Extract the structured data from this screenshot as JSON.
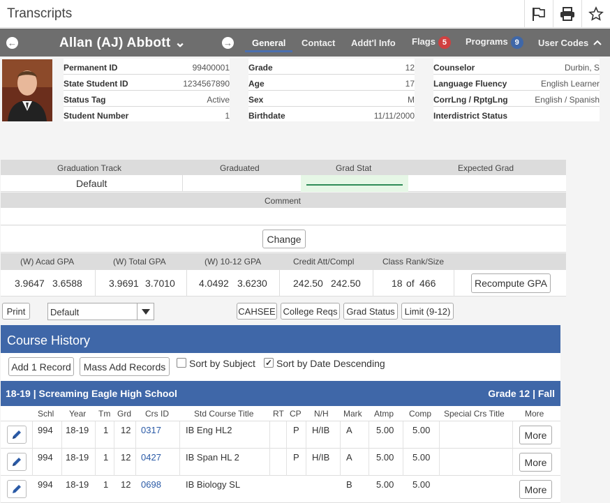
{
  "app": {
    "title": "Transcripts"
  },
  "header": {
    "student_name": "Allan (AJ) Abbott ⌄",
    "tabs": [
      {
        "label": "General"
      },
      {
        "label": "Contact"
      },
      {
        "label": "Addt'l Info"
      },
      {
        "label": "Flags",
        "badge": "5"
      },
      {
        "label": "Programs",
        "badge": "9"
      },
      {
        "label": "User Codes"
      }
    ],
    "colors": {
      "bar": "#6e6e6e",
      "flags_badge": "#d04040",
      "programs_badge": "#3f67a8"
    }
  },
  "student_info": {
    "col1": [
      {
        "label": "Permanent ID",
        "value": "99400001"
      },
      {
        "label": "State Student ID",
        "value": "1234567890"
      },
      {
        "label": "Status Tag",
        "value": "Active"
      },
      {
        "label": "Student Number",
        "value": "1"
      }
    ],
    "col2": [
      {
        "label": "Grade",
        "value": "12"
      },
      {
        "label": "Age",
        "value": "17"
      },
      {
        "label": "Sex",
        "value": "M"
      },
      {
        "label": "Birthdate",
        "value": "11/11/2000"
      }
    ],
    "col3": [
      {
        "label": "Counselor",
        "value": "Durbin, S"
      },
      {
        "label": "Language Fluency",
        "value": "English Learner"
      },
      {
        "label": "CorrLng / RptgLng",
        "value": "English / Spanish"
      },
      {
        "label": "Interdistrict Status",
        "value": ""
      }
    ]
  },
  "graduation": {
    "headers": [
      "Graduation Track",
      "Graduated",
      "Grad Stat",
      "Expected Grad"
    ],
    "track_value": "Default",
    "comment_label": "Comment",
    "change_button": "Change"
  },
  "gpa": {
    "headers": [
      "(W) Acad GPA",
      "(W) Total GPA",
      "(W) 10-12 GPA",
      "Credit Att/Compl",
      "Class Rank/Size"
    ],
    "acad": [
      "3.9647",
      "3.6588"
    ],
    "total": [
      "3.9691",
      "3.7010"
    ],
    "ten_twelve": [
      "4.0492",
      "3.6230"
    ],
    "credit": [
      "242.50",
      "242.50"
    ],
    "rank": "18",
    "rank_of": "of",
    "size": "466",
    "recompute_button": "Recompute GPA"
  },
  "toolbar": {
    "print": "Print",
    "select_value": "Default",
    "cahsee": "CAHSEE",
    "college_reqs": "College Reqs",
    "grad_status": "Grad Status",
    "limit": "Limit (9-12)"
  },
  "course_history": {
    "title": "Course History",
    "add_record": "Add 1 Record",
    "mass_add": "Mass Add Records",
    "sort_subject": {
      "label": "Sort by Subject",
      "checked": false
    },
    "sort_date": {
      "label": "Sort by Date Descending",
      "checked": true
    },
    "school_header": {
      "left": "18-19 | Screaming Eagle High School",
      "right": "Grade 12 | Fall"
    },
    "columns": [
      "Schl",
      "Year",
      "Tm",
      "Grd",
      "Crs ID",
      "Std Course Title",
      "RT",
      "CP",
      "N/H",
      "Mark",
      "Atmp",
      "Comp",
      "Special Crs Title",
      "More"
    ],
    "rows": [
      {
        "schl": "994",
        "year": "18-19",
        "tm": "1",
        "grd": "12",
        "crs_id": "0317",
        "title": "IB Eng HL2",
        "rt": "",
        "cp": "P",
        "nh": "H/IB",
        "mark": "A",
        "atmp": "5.00",
        "comp": "5.00",
        "special": "",
        "more": "More"
      },
      {
        "schl": "994",
        "year": "18-19",
        "tm": "1",
        "grd": "12",
        "crs_id": "0427",
        "title": "IB Span HL 2",
        "rt": "",
        "cp": "P",
        "nh": "H/IB",
        "mark": "A",
        "atmp": "5.00",
        "comp": "5.00",
        "special": "",
        "more": "More"
      },
      {
        "schl": "994",
        "year": "18-19",
        "tm": "1",
        "grd": "12",
        "crs_id": "0698",
        "title": "IB Biology SL",
        "rt": "",
        "cp": "",
        "nh": "",
        "mark": "B",
        "atmp": "5.00",
        "comp": "5.00",
        "special": "",
        "more": "More"
      }
    ]
  }
}
